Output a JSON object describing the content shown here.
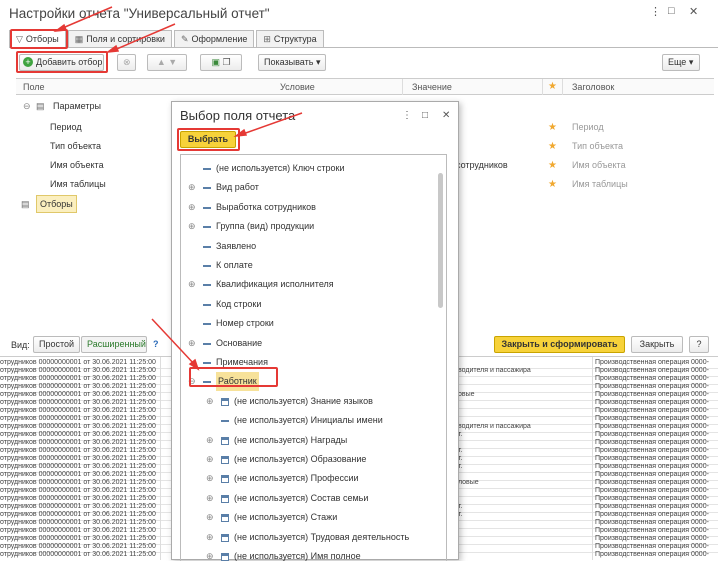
{
  "window": {
    "title": "Настройки отчета \"Универсальный отчет\"",
    "controls": [
      "⋮",
      "□",
      "✕"
    ]
  },
  "tabs": [
    {
      "label": "Отборы",
      "icon": "filter-icon"
    },
    {
      "label": "Поля и сортировки",
      "icon": "fields-icon"
    },
    {
      "label": "Оформление",
      "icon": "brush-icon"
    },
    {
      "label": "Структура",
      "icon": "structure-icon"
    }
  ],
  "toolbar": {
    "add_filter": "Добавить отбор",
    "show": "Показывать",
    "more": "Еще"
  },
  "grid": {
    "columns": {
      "field": "Поле",
      "condition": "Условие",
      "value": "Значение",
      "header": "Заголовок"
    },
    "group": "Параметры",
    "rows": [
      {
        "name": "Период",
        "condition": "",
        "header": "Период"
      },
      {
        "name": "Тип объекта",
        "condition": "",
        "header": "Тип объекта"
      },
      {
        "name": "Имя объекта",
        "condition": "сотрудников",
        "header": "Имя объекта"
      },
      {
        "name": "Имя таблицы",
        "condition": "",
        "header": "Имя таблицы"
      }
    ],
    "selected": "Отборы"
  },
  "bottom": {
    "view_label": "Вид:",
    "simple": "Простой",
    "extended": "Расширенный",
    "help": "?",
    "close_and_generate": "Закрыть и сформировать",
    "close": "Закрыть"
  },
  "background_rows": [
    {
      "a": "отрудников 00000000001 от 30.06.2021 11:25:00",
      "b": "",
      "c": "Производственная операция 0000-"
    },
    {
      "a": "отрудников 00000000001 от 30.06.2021 11:25:00",
      "b": "водителя и пассажира",
      "c": "Производственная операция 0000-"
    },
    {
      "a": "отрудников 00000000001 от 30.06.2021 11:25:00",
      "b": "",
      "c": "Производственная операция 0000-"
    },
    {
      "a": "отрудников 00000000001 от 30.06.2021 11:25:00",
      "b": "",
      "c": "Производственная операция 0000-"
    },
    {
      "a": "отрудников 00000000001 от 30.06.2021 11:25:00",
      "b": "овые",
      "c": "Производственная операция 0000-"
    },
    {
      "a": "отрудников 00000000001 от 30.06.2021 11:25:00",
      "b": "",
      "c": "Производственная операция 0000-"
    },
    {
      "a": "отрудников 00000000001 от 30.06.2021 11:25:00",
      "b": "",
      "c": "Производственная операция 0000-"
    },
    {
      "a": "отрудников 00000000001 от 30.06.2021 11:25:00",
      "b": "",
      "c": "Производственная операция 0000-"
    },
    {
      "a": "отрудников 00000000001 от 30.06.2021 11:25:00",
      "b": "водителя и пассажира",
      "c": "Производственная операция 0000-"
    },
    {
      "a": "отрудников 00000000001 от 30.06.2021 11:25:00",
      "b": "т.",
      "c": "Производственная операция 0000-"
    },
    {
      "a": "отрудников 00000000001 от 30.06.2021 11:25:00",
      "b": "",
      "c": "Производственная операция 0000-"
    },
    {
      "a": "отрудников 00000000001 от 30.06.2021 11:25:00",
      "b": "т.",
      "c": "Производственная операция 0000-"
    },
    {
      "a": "отрудников 00000000001 от 30.06.2021 11:25:00",
      "b": "т.",
      "c": "Производственная операция 0000-"
    },
    {
      "a": "отрудников 00000000001 от 30.06.2021 11:25:00",
      "b": "т.",
      "c": "Производственная операция 0000-"
    },
    {
      "a": "отрудников 00000000001 от 30.06.2021 11:25:00",
      "b": "",
      "c": "Производственная операция 0000-"
    },
    {
      "a": "отрудников 00000000001 от 30.06.2021 11:25:00",
      "b": "ловые",
      "c": "Производственная операция 0000-"
    },
    {
      "a": "отрудников 00000000001 от 30.06.2021 11:25:00",
      "b": "",
      "c": "Производственная операция 0000-"
    },
    {
      "a": "отрудников 00000000001 от 30.06.2021 11:25:00",
      "b": "",
      "c": "Производственная операция 0000-"
    },
    {
      "a": "отрудников 00000000001 от 30.06.2021 11:25:00",
      "b": "т.",
      "c": "Производственная операция 0000-"
    },
    {
      "a": "отрудников 00000000001 от 30.06.2021 11:25:00",
      "b": "т.",
      "c": "Производственная операция 0000-"
    },
    {
      "a": "отрудников 00000000001 от 30.06.2021 11:25:00",
      "b": "",
      "c": "Производственная операция 0000-"
    },
    {
      "a": "отрудников 00000000001 от 30.06.2021 11:25:00",
      "b": "",
      "c": "Производственная операция 0000-"
    },
    {
      "a": "отрудников 00000000001 от 30.06.2021 11:25:00",
      "b": "",
      "c": "Производственная операция 0000-"
    },
    {
      "a": "отрудников 00000000001 от 30.06.2021 11:25:00",
      "b": "",
      "c": "Производственная операция 0000-"
    },
    {
      "a": "отрудников 00000000001 от 30.06.2021 11:25:00",
      "b": "",
      "c": "Производственная операция 0000-"
    }
  ],
  "dialog": {
    "title": "Выбор поля отчета",
    "select_button": "Выбрать",
    "items": [
      {
        "label": "(не используется) Ключ строки",
        "expandable": false,
        "icon": "dash-icon",
        "level": 0
      },
      {
        "label": "Вид работ",
        "expandable": true,
        "icon": "dash-icon",
        "level": 0
      },
      {
        "label": "Выработка сотрудников",
        "expandable": true,
        "icon": "dash-icon",
        "level": 0
      },
      {
        "label": "Группа (вид) продукции",
        "expandable": true,
        "icon": "dash-icon",
        "level": 0
      },
      {
        "label": "Заявлено",
        "expandable": false,
        "icon": "dash-icon",
        "level": 0
      },
      {
        "label": "К оплате",
        "expandable": false,
        "icon": "dash-icon",
        "level": 0
      },
      {
        "label": "Квалификация исполнителя",
        "expandable": true,
        "icon": "dash-icon",
        "level": 0
      },
      {
        "label": "Код строки",
        "expandable": false,
        "icon": "dash-icon",
        "level": 0
      },
      {
        "label": "Номер строки",
        "expandable": false,
        "icon": "dash-icon",
        "level": 0
      },
      {
        "label": "Основание",
        "expandable": true,
        "icon": "dash-icon",
        "level": 0
      },
      {
        "label": "Примечания",
        "expandable": false,
        "icon": "dash-icon",
        "level": 0
      },
      {
        "label": "Работник",
        "expandable": true,
        "expanded": true,
        "icon": "dash-icon",
        "level": 0,
        "highlighted": true
      },
      {
        "label": "(не используется) Знание языков",
        "expandable": true,
        "icon": "table-icon",
        "level": 1
      },
      {
        "label": "(не используется) Инициалы имени",
        "expandable": false,
        "icon": "dash-icon",
        "level": 1
      },
      {
        "label": "(не используется) Награды",
        "expandable": true,
        "icon": "table-icon",
        "level": 1
      },
      {
        "label": "(не используется) Образование",
        "expandable": true,
        "icon": "table-icon",
        "level": 1
      },
      {
        "label": "(не используется) Профессии",
        "expandable": true,
        "icon": "table-icon",
        "level": 1
      },
      {
        "label": "(не используется) Состав семьи",
        "expandable": true,
        "icon": "table-icon",
        "level": 1
      },
      {
        "label": "(не используется) Стажи",
        "expandable": true,
        "icon": "table-icon",
        "level": 1
      },
      {
        "label": "(не используется) Трудовая деятельность",
        "expandable": true,
        "icon": "table-icon",
        "level": 1
      },
      {
        "label": "(не используется) Имя полное",
        "expandable": true,
        "icon": "table-icon",
        "level": 1
      }
    ]
  },
  "colors": {
    "accent": "#f7d23a",
    "annotation": "#e53935",
    "selected_row": "#fbefbf"
  }
}
